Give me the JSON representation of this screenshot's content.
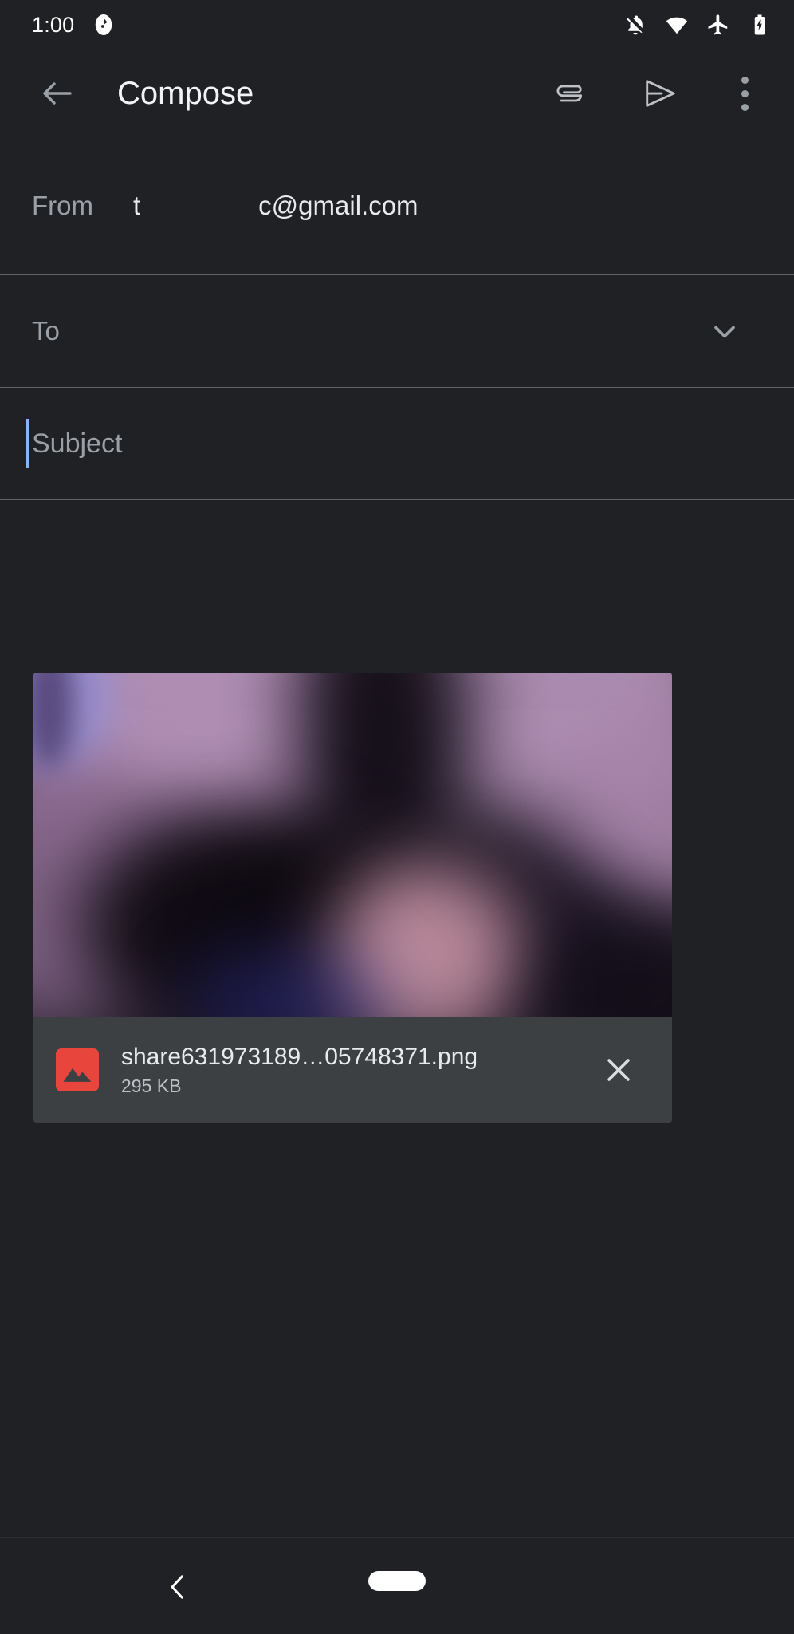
{
  "status_bar": {
    "clock": "1:00",
    "app_icon": "clock-app-icon",
    "icons": [
      {
        "name": "notifications-off-icon",
        "label": "Notifications silenced"
      },
      {
        "name": "wifi-icon",
        "label": "Wi-Fi full signal"
      },
      {
        "name": "airplane-mode-icon",
        "label": "Airplane mode on"
      },
      {
        "name": "battery-charging-icon",
        "label": "Battery charging"
      }
    ]
  },
  "toolbar": {
    "back_label": "Back",
    "title": "Compose",
    "attach_label": "Attach file",
    "send_label": "Send",
    "more_label": "More options"
  },
  "fields": {
    "from": {
      "label": "From",
      "address_prefix": "t",
      "address_suffix": "c@gmail.com"
    },
    "to": {
      "placeholder": "To",
      "expand_label": "Show Cc/Bcc"
    },
    "subject": {
      "placeholder": "Subject",
      "value": "",
      "caret_color": "#8ab4f8",
      "focused": true
    },
    "body": {
      "placeholder": "",
      "value": ""
    }
  },
  "attachment": {
    "file_name": "share631973189…05748371.png",
    "file_size": "295 KB",
    "file_type_icon": "image-file-icon",
    "icon_color": "#e8453c",
    "remove_label": "Remove attachment",
    "preview_alt": "Blurred purple photo preview"
  },
  "nav_bar": {
    "back_label": "Back",
    "home_label": "Home"
  },
  "colors": {
    "background": "#202124",
    "divider": "#5f6368",
    "card": "#3c4043",
    "primary_text": "#e8eaed",
    "secondary_text": "#9aa0a6",
    "accent": "#8ab4f8",
    "attachment_icon": "#e8453c"
  }
}
